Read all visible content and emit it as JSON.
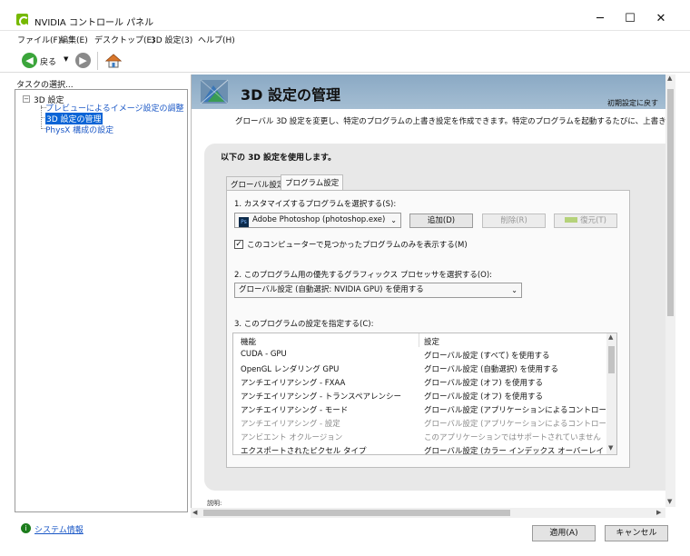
{
  "window": {
    "title": "NVIDIA コントロール パネル",
    "controls": {
      "minimize": "─",
      "maximize": "☐",
      "close": "✕"
    }
  },
  "menubar": [
    "ファイル(F)",
    "編集(E)",
    "デスクトップ(E)",
    "3D 設定(3)",
    "ヘルプ(H)"
  ],
  "toolbar": {
    "back_label": "戻る",
    "back_icon": "arrow-left-circle",
    "forward_icon": "arrow-right-circle",
    "home_icon": "home"
  },
  "sidebar": {
    "title": "タスクの選択...",
    "root_toggle": "−",
    "root": "3D 設定",
    "items": [
      "プレビューによるイメージ設定の調整",
      "3D 設定の管理",
      "PhysX 構成の設定"
    ],
    "selected_index": 1,
    "system_info": "システム情報"
  },
  "main": {
    "title": "3D 設定の管理",
    "restore_default": "初期設定に戻す",
    "description": "グローバル 3D 設定を変更し、特定のプログラムの上書き設定を作成できます。特定のプログラムを起動するたびに、上書き設定が自動",
    "section_title": "以下の 3D 設定を使用します。",
    "tabs": [
      "グローバル設定",
      "プログラム設定"
    ],
    "active_tab": 1,
    "step1_label": "1. カスタマイズするプログラムを選択する(S):",
    "program_select": "Adobe Photoshop (photoshop.exe)",
    "program_icon_text": "Ps",
    "add_button": "追加(D)",
    "remove_button": "削除(R)",
    "restore_button": "復元(T)",
    "checkbox_checked": true,
    "checkbox_label": "このコンピューターで見つかったプログラムのみを表示する(M)",
    "step2_label": "2. このプログラム用の優先するグラフィックス プロセッサを選択する(O):",
    "gpu_select": "グローバル設定 (自動選択: NVIDIA GPU) を使用する",
    "step3_label": "3. このプログラムの設定を指定する(C):",
    "table_headers": [
      "機能",
      "設定"
    ],
    "table_rows": [
      {
        "feature": "CUDA - GPU",
        "setting": "グローバル設定 (すべて) を使用する",
        "dim": false
      },
      {
        "feature": "OpenGL レンダリング GPU",
        "setting": "グローバル設定 (自動選択) を使用する",
        "dim": false
      },
      {
        "feature": "アンチエイリアシング - FXAA",
        "setting": "グローバル設定 (オフ) を使用する",
        "dim": false
      },
      {
        "feature": "アンチエイリアシング - トランスペアレンシー",
        "setting": "グローバル設定 (オフ) を使用する",
        "dim": false
      },
      {
        "feature": "アンチエイリアシング - モード",
        "setting": "グローバル設定 (アプリケーションによるコントロール) を...",
        "dim": false
      },
      {
        "feature": "アンチエイリアシング - 設定",
        "setting": "グローバル設定 (アプリケーションによるコントロール) を...",
        "dim": true
      },
      {
        "feature": "アンビエント オクルージョン",
        "setting": "このアプリケーションではサポートされていません",
        "dim": true
      },
      {
        "feature": "エクスポートされたピクセル タイプ",
        "setting": "グローバル設定 (カラー インデックス オーバーレイ (8bp...",
        "dim": false
      }
    ],
    "description_peek": "説明:"
  },
  "footer": {
    "apply_button": "適用(A)",
    "cancel_button": "キャンセル"
  },
  "colors": {
    "selection": "#0a64d6",
    "link": "#1a57c6",
    "header_band": "#8aa9c4",
    "nvidia_green": "#76b900"
  }
}
